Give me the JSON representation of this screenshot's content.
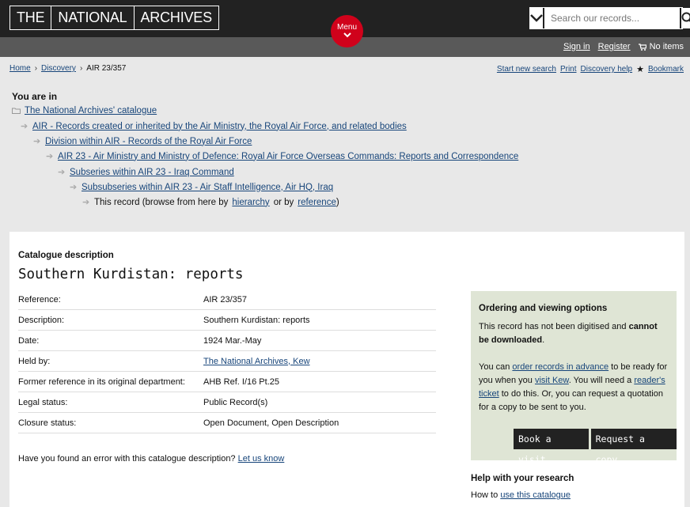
{
  "header": {
    "logo_words": [
      "THE",
      "NATIONAL",
      "ARCHIVES"
    ],
    "search_placeholder": "Search our records...",
    "menu_label": "Menu",
    "sign_in": "Sign in",
    "register": "Register",
    "cart": "No items"
  },
  "breadcrumb": {
    "home": "Home",
    "discovery": "Discovery",
    "current": "AIR 23/357"
  },
  "tools": {
    "new_search": "Start new search",
    "print": "Print",
    "help": "Discovery help",
    "bookmark": "Bookmark"
  },
  "hierarchy": {
    "heading": "You are in",
    "levels": [
      "The National Archives' catalogue",
      "AIR - Records created or inherited by the Air Ministry, the Royal Air Force, and related bodies",
      "Division within AIR - Records of the Royal Air Force",
      "AIR 23 - Air Ministry and Ministry of Defence: Royal Air Force Overseas Commands: Reports and Correspondence",
      "Subseries within AIR 23 - Iraq Command",
      "Subsubseries within AIR 23 - Air Staff Intelligence, Air HQ, Iraq"
    ],
    "this_record_prefix": "This record (browse from here by",
    "hierarchy_link": "hierarchy",
    "or_by": "or by",
    "reference_link": "reference",
    "close_paren": ")"
  },
  "record": {
    "section_label": "Catalogue description",
    "title": "Southern Kurdistan: reports",
    "details": [
      {
        "key": "Reference:",
        "value": "AIR 23/357"
      },
      {
        "key": "Description:",
        "value": "Southern Kurdistan: reports"
      },
      {
        "key": "Date:",
        "value": "1924 Mar.-May"
      },
      {
        "key": "Held by:",
        "value": "The National Archives, Kew"
      },
      {
        "key": "Former reference in its original department:",
        "value": "AHB Ref. I/16 Pt.25"
      },
      {
        "key": "Legal status:",
        "value": "Public Record(s)"
      },
      {
        "key": "Closure status:",
        "value": "Open Document, Open Description"
      }
    ],
    "error_prompt": "Have you found an error with this catalogue description?",
    "error_link": "Let us know"
  },
  "ordering": {
    "heading": "Ordering and viewing options",
    "p1_start": "This record has not been digitised and",
    "p1_bold": "cannot be downloaded",
    "p1_end": ".",
    "p2_a": "You can",
    "p2_link1": "order records in advance",
    "p2_b": "to be ready for you when you",
    "p2_link2": "visit Kew",
    "p2_c": ". You will need a",
    "p2_link3": "reader's ticket",
    "p2_d": "to do this. Or, you can request a quotation for a copy to be sent to you.",
    "book_visit": "Book a visit",
    "request_copy": "Request a copy"
  },
  "help": {
    "heading": "Help with your research",
    "how_to": "How to",
    "use_catalogue": "use this catalogue"
  }
}
